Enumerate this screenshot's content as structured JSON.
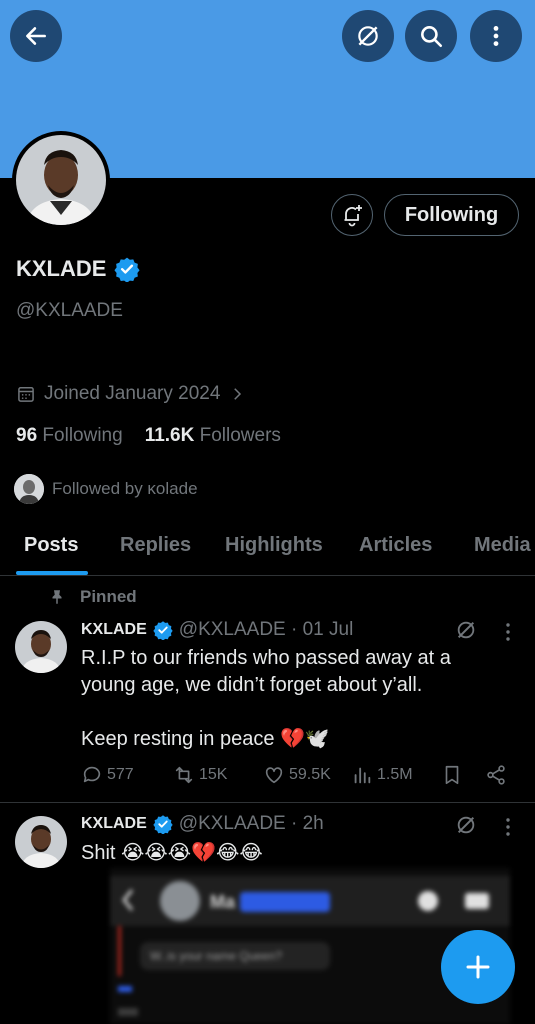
{
  "profile": {
    "name": "KXLADE",
    "handle": "@KXLAADE",
    "joined": "Joined January 2024",
    "following_count": "96",
    "following_label": "Following",
    "followers_count": "11.6K",
    "followers_label": "Followers",
    "followed_by": "Followed by κolade",
    "follow_button": "Following"
  },
  "tabs": [
    {
      "label": "Posts",
      "active": true
    },
    {
      "label": "Replies"
    },
    {
      "label": "Highlights"
    },
    {
      "label": "Articles"
    },
    {
      "label": "Media"
    }
  ],
  "posts": [
    {
      "pinned_label": "Pinned",
      "name": "KXLADE",
      "handle_time": "@KXLAADE · 01 Jul",
      "text_line1": "R.I.P to our friends who passed away at a",
      "text_line2": "young age, we didn’t forget about y’all.",
      "text_line3": "Keep resting in peace 💔🕊️",
      "replies": "577",
      "reposts": "15K",
      "likes": "59.5K",
      "views": "1.5M"
    },
    {
      "name": "KXLADE",
      "handle_time": "@KXLAADE · 2h",
      "text": "Shit 😭😭😭💔😂😂",
      "embedded_image_labels": [
        "Ma",
        "W..is your name Queen?"
      ]
    }
  ],
  "colors": {
    "banner": "#4a9ae6",
    "accent": "#1d9bf0",
    "verified": "#1d9bf0",
    "muted_text": "#71767b"
  },
  "icons": [
    "back-arrow-icon",
    "grok-icon",
    "search-icon",
    "more-vertical-icon",
    "bell-plus-icon",
    "verified-icon",
    "calendar-icon",
    "chevron-right-icon",
    "pin-icon",
    "reply-icon",
    "repost-icon",
    "like-icon",
    "views-icon",
    "bookmark-icon",
    "share-icon",
    "plus-icon"
  ]
}
